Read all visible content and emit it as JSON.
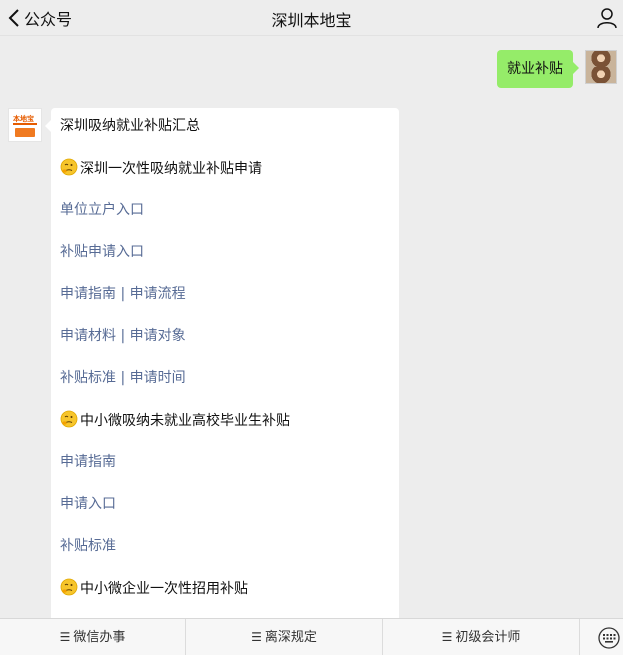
{
  "header": {
    "back_label": "公众号",
    "title": "深圳本地宝"
  },
  "me_message": "就业补贴",
  "bot_message": {
    "avatar_text_top": "本地宝",
    "avatar_text_bottom": "深圳",
    "lines": [
      {
        "text": "深圳吸纳就业补贴汇总",
        "kind": "text",
        "emoji": false
      },
      {
        "text": "深圳一次性吸纳就业补贴申请",
        "kind": "text",
        "emoji": true
      },
      {
        "text": "单位立户入口",
        "kind": "link",
        "emoji": false
      },
      {
        "text": "补贴申请入口",
        "kind": "link",
        "emoji": false
      },
      {
        "text": "申请指南 | 申请流程",
        "kind": "link",
        "emoji": false
      },
      {
        "text": "申请材料 | 申请对象",
        "kind": "link",
        "emoji": false
      },
      {
        "text": "补贴标准 | 申请时间",
        "kind": "link",
        "emoji": false
      },
      {
        "text": "中小微吸纳未就业高校毕业生补贴",
        "kind": "text",
        "emoji": true
      },
      {
        "text": "申请指南",
        "kind": "link",
        "emoji": false
      },
      {
        "text": "申请入口",
        "kind": "link",
        "emoji": false
      },
      {
        "text": "补贴标准",
        "kind": "link",
        "emoji": false
      },
      {
        "text": "中小微企业一次性招用补贴",
        "kind": "text",
        "emoji": true
      }
    ]
  },
  "bottom_menu": {
    "items": [
      "微信办事",
      "离深规定",
      "初级会计师"
    ],
    "menu_icon": "hamburger-icon",
    "keyboard_icon": "keyboard-icon"
  },
  "colors": {
    "bubble_me": "#95ec69",
    "link": "#576b95",
    "background": "#ededed"
  }
}
